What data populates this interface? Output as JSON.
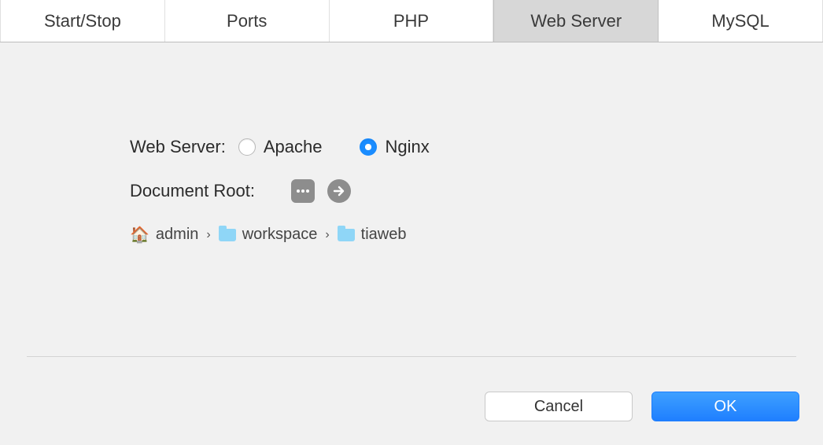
{
  "tabs": [
    "Start/Stop",
    "Ports",
    "PHP",
    "Web Server",
    "MySQL"
  ],
  "activeTabIndex": 3,
  "form": {
    "webServerLabel": "Web Server:",
    "options": {
      "apache": "Apache",
      "nginx": "Nginx"
    },
    "selected": "nginx",
    "docRootLabel": "Document Root:",
    "path": [
      "admin",
      "workspace",
      "tiaweb"
    ]
  },
  "buttons": {
    "cancel": "Cancel",
    "ok": "OK"
  }
}
